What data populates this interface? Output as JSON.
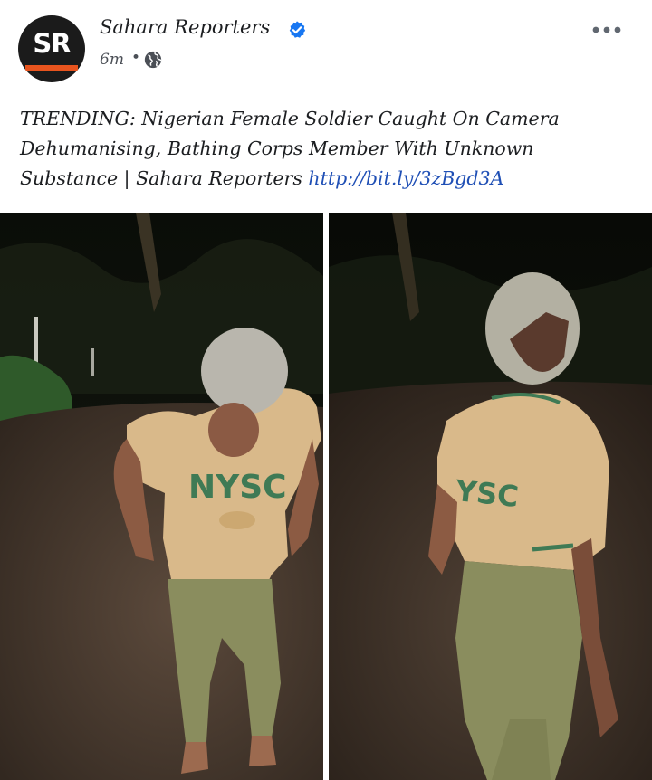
{
  "page": {
    "name": "Sahara Reporters",
    "avatar_text": "SR",
    "timestamp": "6m",
    "separator": "•"
  },
  "post": {
    "text": "TRENDING: Nigerian Female Soldier Caught On Camera Dehumanising, Bathing Corps Member With Unknown Substance | Sahara Reporters",
    "link": "http://bit.ly/3zBgd3A"
  },
  "photos": {
    "left": {
      "shirt_text": "NYSC"
    },
    "right": {
      "shirt_text": "YSC"
    }
  },
  "icons": {
    "verified": "verified-badge-icon",
    "privacy": "globe-icon",
    "more": "more-options-icon"
  },
  "colors": {
    "verified_blue": "#1877f2",
    "link_blue": "#1f4fb5",
    "avatar_accent": "#e8541e",
    "shirt_khaki": "#d9b98a",
    "trousers_olive": "#8a8d5e",
    "nysc_green": "#3f7a55"
  }
}
